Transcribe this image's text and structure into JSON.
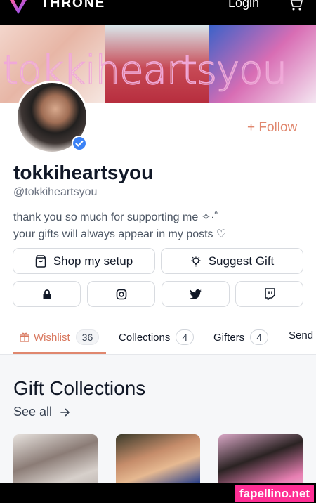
{
  "nav": {
    "brand": "THRONE",
    "login": "Login",
    "logo_icon": "throne-logo-icon",
    "cart_icon": "cart-icon"
  },
  "banner": {
    "overlay_text": "tokkiheartsyou"
  },
  "profile": {
    "name": "tokkiheartsyou",
    "handle": "@tokkiheartsyou",
    "bio_line1": "thank you so much for supporting me ✧·˚",
    "bio_line2": "your gifts will always appear in my posts ♡",
    "verified": true,
    "follow_label": "+ Follow"
  },
  "actions": {
    "shop_label": "Shop my setup",
    "suggest_label": "Suggest Gift",
    "social_icons": [
      "lock-icon",
      "instagram-icon",
      "twitter-icon",
      "twitch-icon"
    ]
  },
  "tabs": [
    {
      "label": "Wishlist",
      "count": "36",
      "active": true
    },
    {
      "label": "Collections",
      "count": "4"
    },
    {
      "label": "Gifters",
      "count": "4"
    },
    {
      "label": "Send S"
    }
  ],
  "collections": {
    "title": "Gift Collections",
    "see_all": "See all"
  },
  "watermark": "fapellino.net",
  "colors": {
    "accent": "#e0876e",
    "nav_bg": "#000000",
    "watermark_bg": "#ff2e94",
    "verified_blue": "#3b82f6"
  }
}
